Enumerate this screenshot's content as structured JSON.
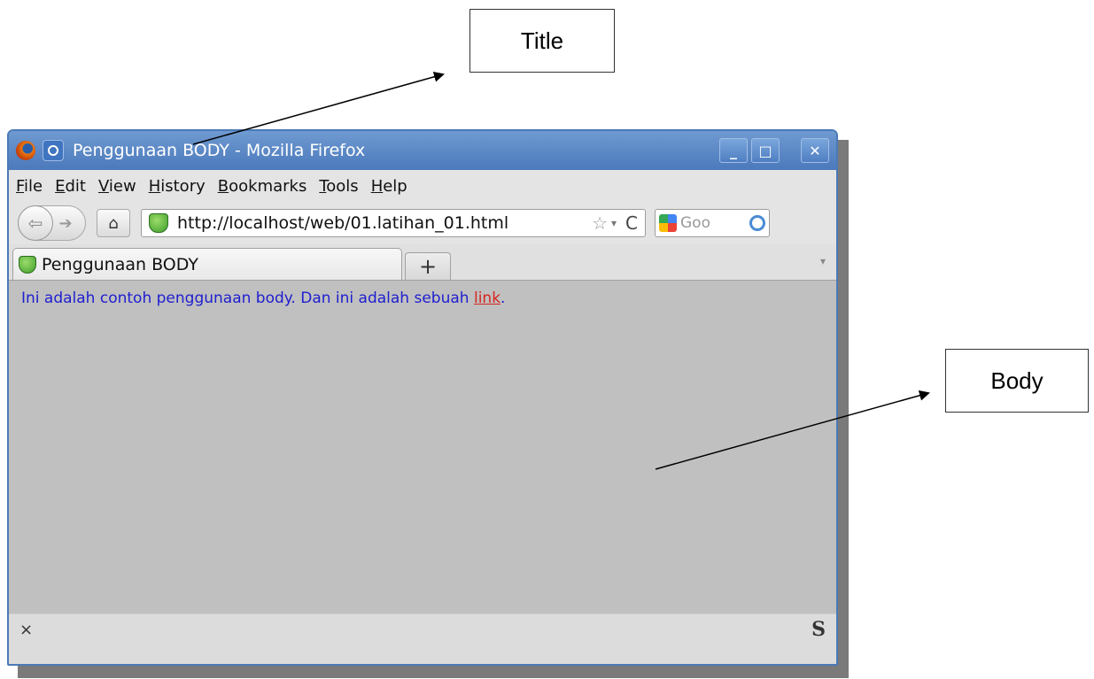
{
  "callouts": {
    "title": "Title",
    "body": "Body"
  },
  "window": {
    "title": "Penggunaan BODY - Mozilla Firefox",
    "controls": {
      "minimize": "_",
      "maximize": "□",
      "close": "✕"
    }
  },
  "menu": [
    "File",
    "Edit",
    "View",
    "History",
    "Bookmarks",
    "Tools",
    "Help"
  ],
  "nav": {
    "back": "⇦",
    "forward": "➔",
    "home": "⌂",
    "url": "http://localhost/web/01.latihan_01.html",
    "star": "☆",
    "dropdown": "▾",
    "reload": "C",
    "search_text": "Goo"
  },
  "tabs": [
    {
      "label": "Penggunaan BODY"
    }
  ],
  "new_tab": "+",
  "tab_list": "▾",
  "page": {
    "text_before": "Ini adalah contoh penggunaan body. Dan ini adalah sebuah ",
    "link": "link",
    "text_after": "."
  },
  "status": {
    "close": "×",
    "addon": "S"
  },
  "colors": {
    "page_bg": "#c0c0c0",
    "text": "#1e1ed0",
    "link": "#d8241e",
    "titlebar": "#4b79bb"
  },
  "icons": [
    "firefox-icon",
    "page-icon",
    "shield-icon",
    "star-icon",
    "reload-icon",
    "google-icon",
    "magnifier-icon",
    "home-icon",
    "back-icon",
    "forward-icon"
  ]
}
